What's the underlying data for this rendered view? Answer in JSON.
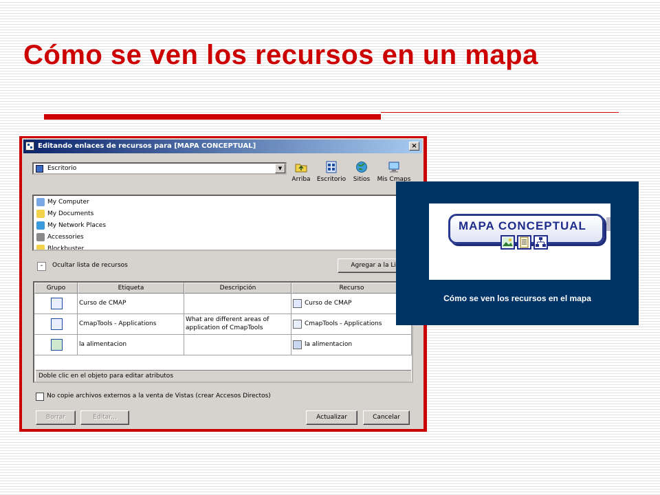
{
  "slide": {
    "title": "Cómo se ven los recursos en un mapa",
    "accent_color": "#cc0000"
  },
  "dialog": {
    "title": "Editando enlaces de recursos para [MAPA CONCEPTUAL]",
    "close_label": "×",
    "location": {
      "value": "Escritorio",
      "icon": "desktop-icon"
    },
    "toolbar": [
      {
        "label": "Arriba",
        "icon": "folder-up-icon"
      },
      {
        "label": "Escritorio",
        "icon": "desktop-icon"
      },
      {
        "label": "Sitios",
        "icon": "globe-icon"
      },
      {
        "label": "Mis Cmaps",
        "icon": "computer-icon"
      }
    ],
    "file_list": [
      {
        "label": "My Computer",
        "icon": "computer-icon"
      },
      {
        "label": "My Documents",
        "icon": "folder-icon"
      },
      {
        "label": "My Network Places",
        "icon": "network-icon"
      },
      {
        "label": "Accessories",
        "icon": "tools-icon"
      },
      {
        "label": "Blockbuster",
        "icon": "folder-icon"
      }
    ],
    "toggle_symbol": "-",
    "toggle_label": "Ocultar lista de recursos",
    "add_button_label": "Agregar a la Lista",
    "table": {
      "columns": [
        "Grupo",
        "Etiqueta",
        "Descripción",
        "Recurso"
      ],
      "rows": [
        {
          "group_icon": "document-icon",
          "label": "Curso de CMAP",
          "description": "",
          "resource": "Curso de CMAP",
          "resource_icon": "word-document-icon"
        },
        {
          "group_icon": "concept-map-icon",
          "label": "CmapTools - Applications",
          "description_line1": "What are different areas of",
          "description_line2": "application of CmapTools",
          "resource": "CmapTools - Applications",
          "resource_icon": "concept-map-icon"
        },
        {
          "group_icon": "image-icon",
          "label": "la alimentacion",
          "description": "",
          "resource": "la alimentacion",
          "resource_icon": "png-image-icon"
        }
      ],
      "status": "Doble clic en el objeto para editar atributos"
    },
    "checkbox_label": "No copie archivos externos a la venta de Vistas (crear Accesos Directos)",
    "checkbox_checked": false,
    "buttons": {
      "delete": "Borrar",
      "edit": "Editar...",
      "update": "Actualizar",
      "cancel": "Cancelar"
    }
  },
  "inset": {
    "logo_text": "MAPA CONCEPTUAL",
    "logo_icons": [
      "image-icon",
      "document-icon",
      "concept-map-icon"
    ],
    "caption": "Cómo se ven los recursos en el mapa",
    "background_color": "#003366"
  }
}
